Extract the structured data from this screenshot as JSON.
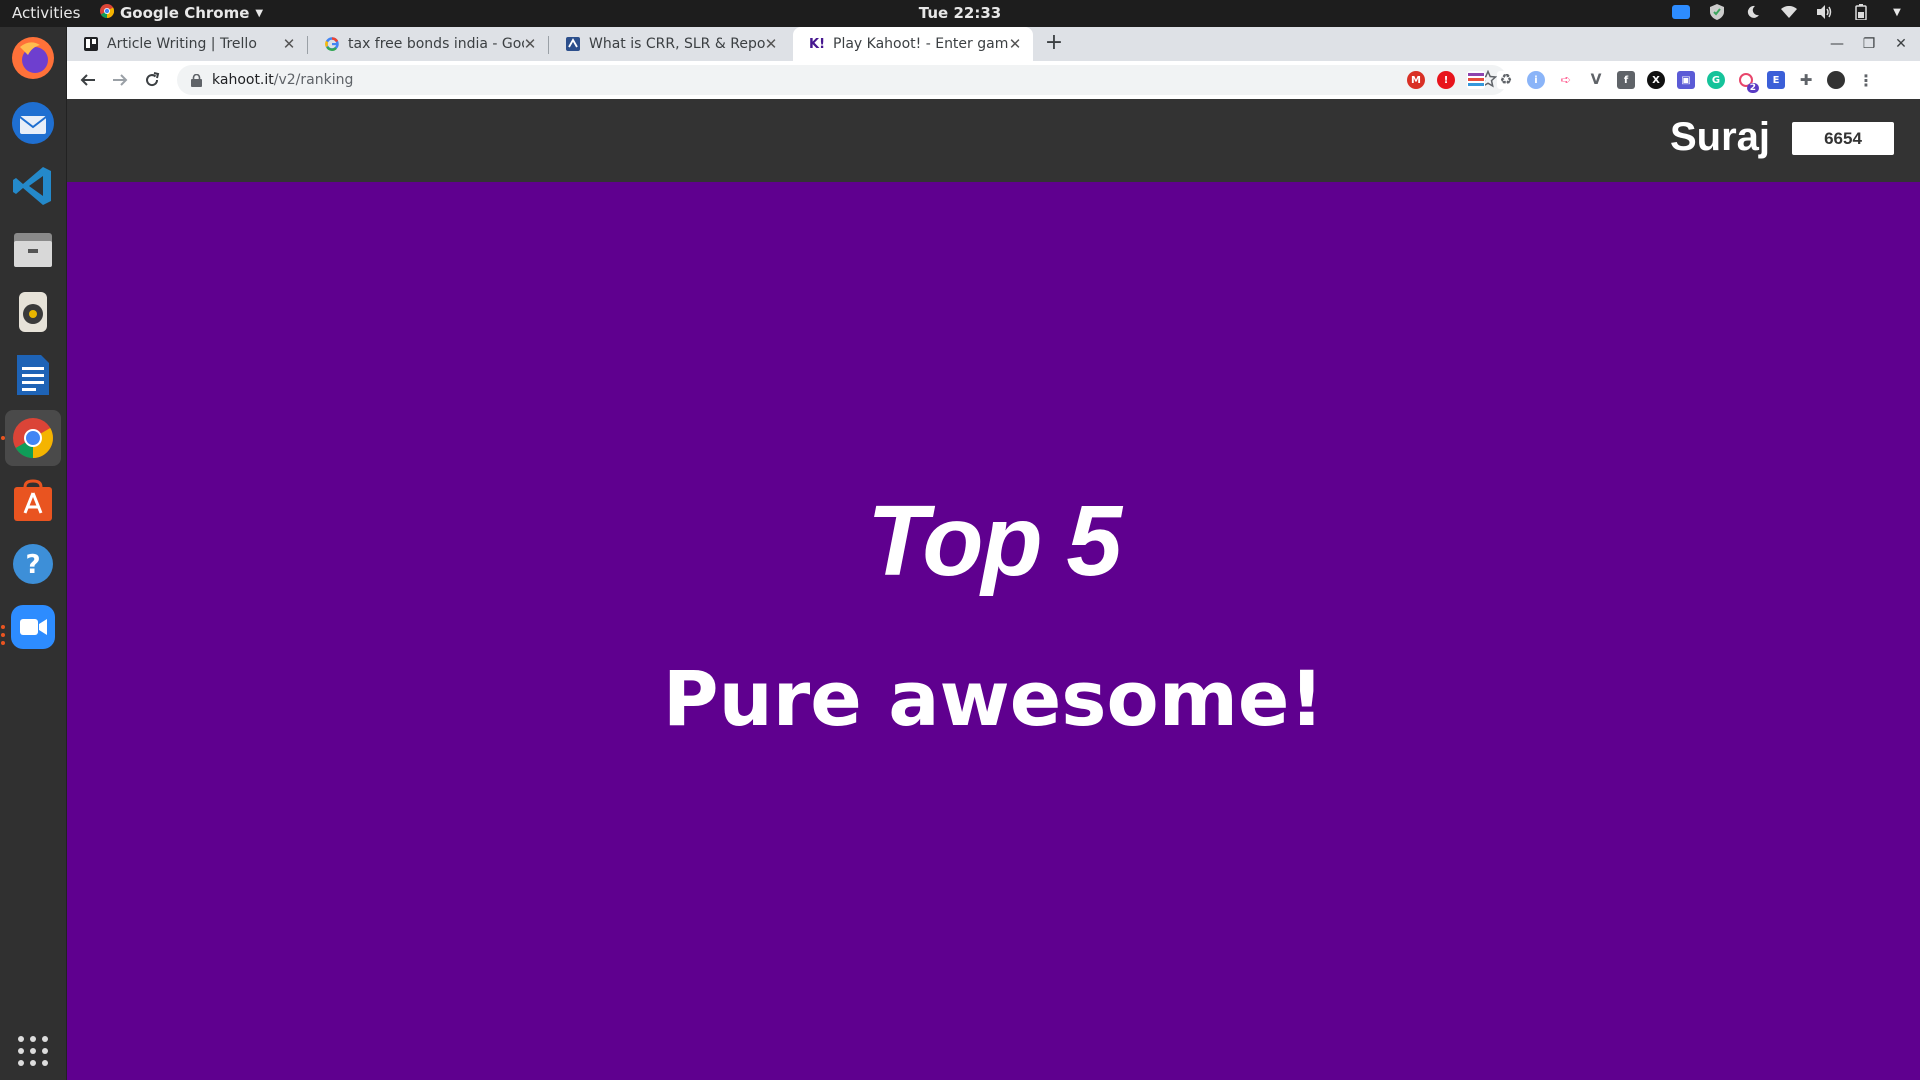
{
  "topbar": {
    "activities": "Activities",
    "app_name": "Google Chrome",
    "clock": "Tue 22:33"
  },
  "dock": {
    "items": [
      "firefox-icon",
      "thunderbird-icon",
      "vscode-icon",
      "files-icon",
      "rhythmbox-icon",
      "writer-icon",
      "chrome-icon",
      "software-icon",
      "help-icon",
      "zoom-icon",
      "app-grid-icon"
    ]
  },
  "browser": {
    "tabs": [
      {
        "title": "Article Writing | Trello",
        "favicon": "trello-icon"
      },
      {
        "title": "tax free bonds india - Goo",
        "favicon": "google-icon"
      },
      {
        "title": "What is CRR, SLR & Repo R",
        "favicon": "article-icon"
      },
      {
        "title": "Play Kahoot! - Enter game",
        "favicon": "kahoot-icon",
        "active": true
      }
    ],
    "url_host": "kahoot.it",
    "url_path": "/v2/ranking",
    "extension_badge": "2"
  },
  "kahoot": {
    "player_name": "Suraj",
    "score": "6654",
    "rank_heading": "Top 5",
    "rank_message": "Pure awesome!",
    "bg_color": "#5f008f",
    "header_color": "#333333"
  }
}
